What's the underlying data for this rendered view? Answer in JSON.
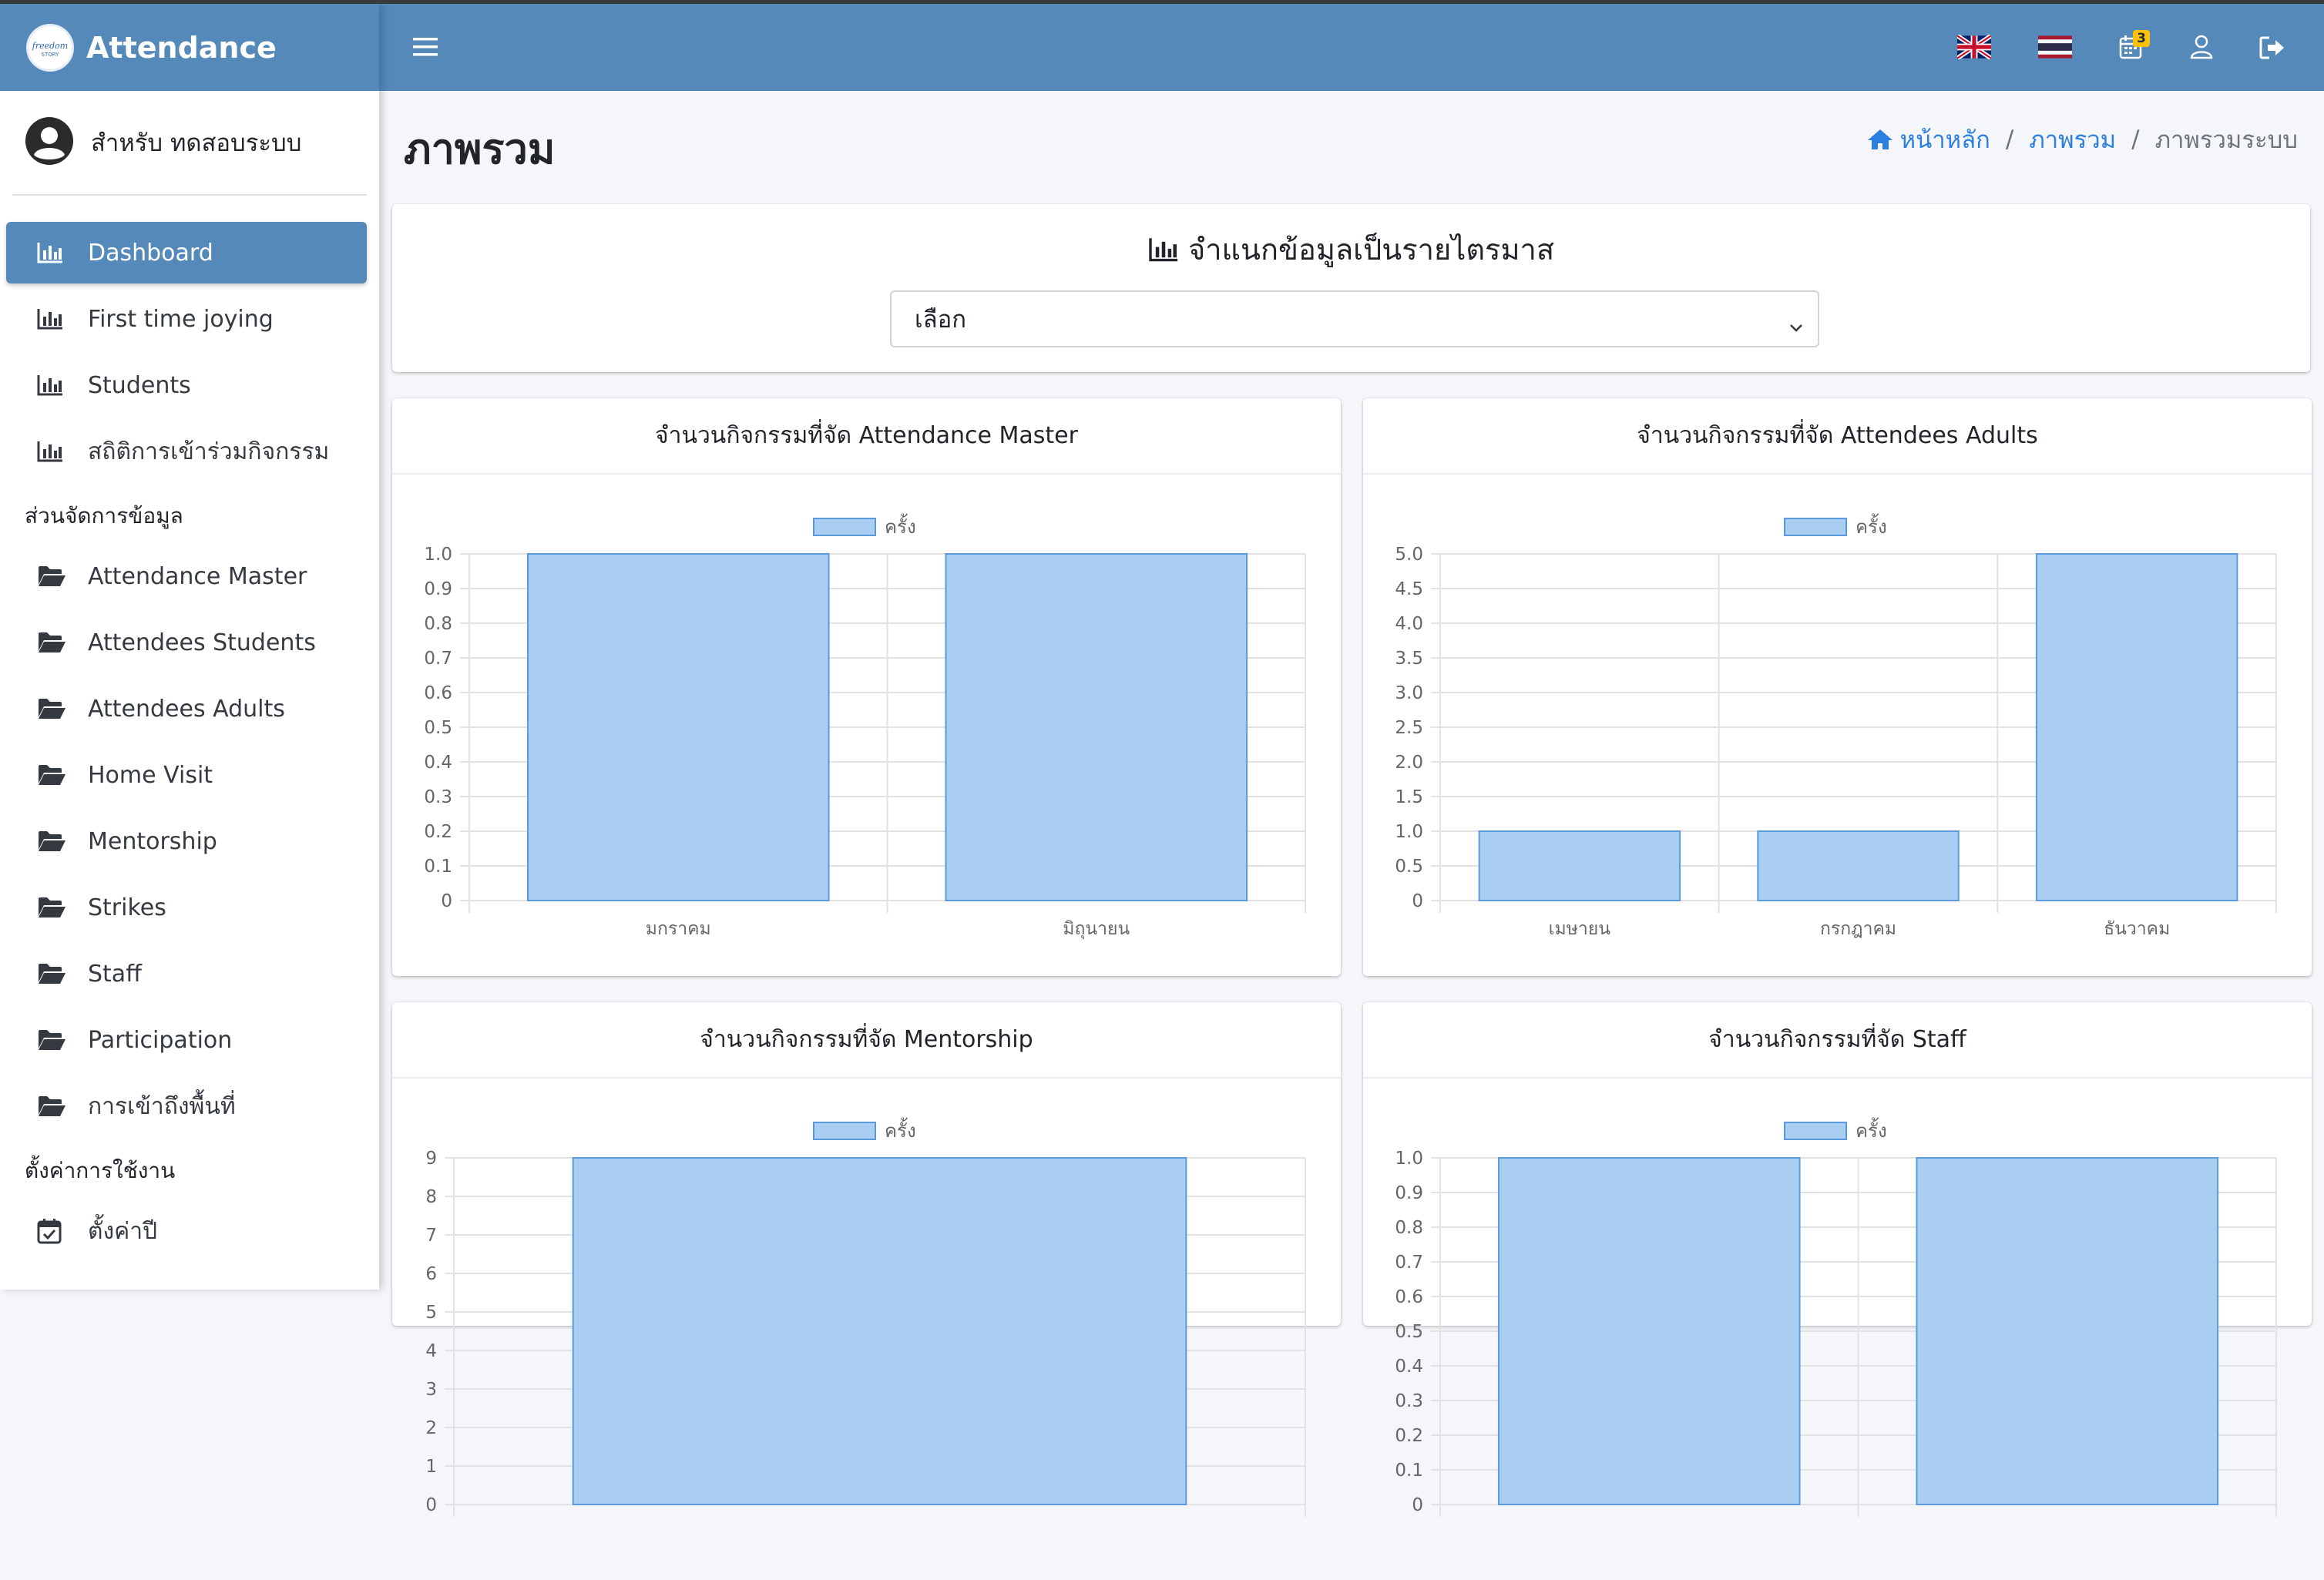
{
  "brand": {
    "title": "Attendance",
    "logo_text": "freedom STORY"
  },
  "user": {
    "name": "สำหรับ ทดสอบระบบ"
  },
  "sidebar": {
    "main_items": [
      {
        "label": "Dashboard",
        "icon": "chart-bar-icon",
        "active": true
      },
      {
        "label": "First time joying",
        "icon": "chart-bar-icon"
      },
      {
        "label": "Students",
        "icon": "chart-bar-icon"
      },
      {
        "label": "สถิติการเข้าร่วมกิจกรรม",
        "icon": "chart-bar-icon"
      }
    ],
    "section_data_label": "ส่วนจัดการข้อมูล",
    "data_items": [
      {
        "label": "Attendance Master",
        "icon": "folder-open-icon"
      },
      {
        "label": "Attendees Students",
        "icon": "folder-open-icon"
      },
      {
        "label": "Attendees Adults",
        "icon": "folder-open-icon"
      },
      {
        "label": "Home Visit",
        "icon": "folder-open-icon"
      },
      {
        "label": "Mentorship",
        "icon": "folder-open-icon"
      },
      {
        "label": "Strikes",
        "icon": "folder-open-icon"
      },
      {
        "label": "Staff",
        "icon": "folder-open-icon"
      },
      {
        "label": "Participation",
        "icon": "folder-open-icon"
      },
      {
        "label": "การเข้าถึงพื้นที่",
        "icon": "folder-open-icon"
      }
    ],
    "section_settings_label": "ตั้งค่าการใช้งาน",
    "settings_items": [
      {
        "label": "ตั้งค่าปี",
        "icon": "calendar-check-icon"
      }
    ]
  },
  "topbar": {
    "notification_count": "3"
  },
  "page": {
    "title": "ภาพรวม",
    "breadcrumb": {
      "home": "หน้าหลัก",
      "section": "ภาพรวม",
      "current": "ภาพรวมระบบ"
    }
  },
  "filter": {
    "title": "จำแนกข้อมูลเป็นรายไตรมาส",
    "select_value": "เลือก"
  },
  "colors": {
    "bar_fill": "#aacdf2",
    "bar_stroke": "#5b9bdc",
    "primary": "#5589ba"
  },
  "chart_data": [
    {
      "type": "bar",
      "title": "จำนวนกิจกรรมที่จัด Attendance Master",
      "series": [
        {
          "name": "ครั้ง",
          "values": [
            1,
            1
          ]
        }
      ],
      "categories": [
        "มกราคม",
        "มิถุนายน"
      ],
      "ylim": [
        0,
        1
      ],
      "yticks": [
        "0",
        "0.1",
        "0.2",
        "0.3",
        "0.4",
        "0.5",
        "0.6",
        "0.7",
        "0.8",
        "0.9",
        "1.0"
      ],
      "grid": true,
      "legend": "top-center"
    },
    {
      "type": "bar",
      "title": "จำนวนกิจกรรมที่จัด Attendees Adults",
      "series": [
        {
          "name": "ครั้ง",
          "values": [
            1,
            1,
            5
          ]
        }
      ],
      "categories": [
        "เมษายน",
        "กรกฎาคม",
        "ธันวาคม"
      ],
      "ylim": [
        0,
        5
      ],
      "yticks": [
        "0",
        "0.5",
        "1.0",
        "1.5",
        "2.0",
        "2.5",
        "3.0",
        "3.5",
        "4.0",
        "4.5",
        "5.0"
      ],
      "grid": true,
      "legend": "top-center"
    },
    {
      "type": "bar",
      "title": "จำนวนกิจกรรมที่จัด Mentorship",
      "series": [
        {
          "name": "ครั้ง",
          "values": [
            9
          ]
        }
      ],
      "categories": [
        ""
      ],
      "ylim": [
        0,
        9
      ],
      "yticks": [
        "0",
        "1",
        "2",
        "3",
        "4",
        "5",
        "6",
        "7",
        "8",
        "9"
      ],
      "grid": true,
      "legend": "top-center"
    },
    {
      "type": "bar",
      "title": "จำนวนกิจกรรมที่จัด Staff",
      "series": [
        {
          "name": "ครั้ง",
          "values": [
            1,
            1
          ]
        }
      ],
      "categories": [
        "",
        ""
      ],
      "ylim": [
        0,
        1
      ],
      "yticks": [
        "0",
        "0.1",
        "0.2",
        "0.3",
        "0.4",
        "0.5",
        "0.6",
        "0.7",
        "0.8",
        "0.9",
        "1.0"
      ],
      "grid": true,
      "legend": "top-center"
    }
  ]
}
